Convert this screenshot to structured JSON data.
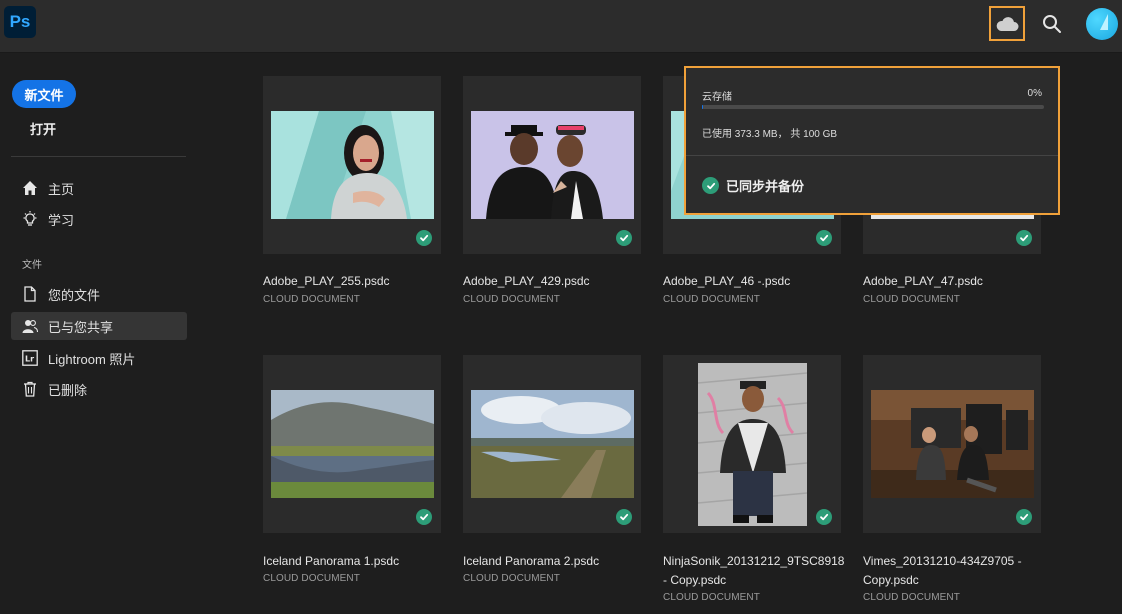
{
  "app": {
    "logo_text": "Ps"
  },
  "header": {
    "cloud_icon": "cloud-icon",
    "search_icon": "search-icon"
  },
  "sidebar": {
    "new_file": "新文件",
    "open": "打开",
    "nav": [
      {
        "label": "主页",
        "icon": "home-icon"
      },
      {
        "label": "学习",
        "icon": "lightbulb-icon"
      }
    ],
    "section_label": "文件",
    "files_nav": [
      {
        "label": "您的文件",
        "icon": "document-icon"
      },
      {
        "label": "已与您共享",
        "icon": "people-icon",
        "active": true
      },
      {
        "label": "Lightroom 照片",
        "icon": "lightroom-icon"
      },
      {
        "label": "已删除",
        "icon": "trash-icon"
      }
    ]
  },
  "files": [
    {
      "name": "Adobe_PLAY_255.psdc",
      "type": "CLOUD DOCUMENT"
    },
    {
      "name": "Adobe_PLAY_429.psdc",
      "type": "CLOUD DOCUMENT"
    },
    {
      "name": "Adobe_PLAY_46 -.psdc",
      "type": "CLOUD DOCUMENT"
    },
    {
      "name": "Adobe_PLAY_47.psdc",
      "type": "CLOUD DOCUMENT"
    },
    {
      "name": "Iceland Panorama 1.psdc",
      "type": "CLOUD DOCUMENT"
    },
    {
      "name": "Iceland Panorama 2.psdc",
      "type": "CLOUD DOCUMENT"
    },
    {
      "name": "NinjaSonik_20131212_9TSC8918 - Copy.psdc",
      "type": "CLOUD DOCUMENT"
    },
    {
      "name": "Vimes_20131210-434Z9705 - Copy.psdc",
      "type": "CLOUD DOCUMENT"
    }
  ],
  "storage": {
    "title": "云存储",
    "percent": "0%",
    "usage_fraction": 0.004,
    "usage_text": "已使用 373.3 MB， 共 100 GB",
    "status": "已同步并备份"
  },
  "colors": {
    "accent": "#1473e6",
    "highlight": "#f0a13a",
    "synced": "#2d9d78"
  }
}
